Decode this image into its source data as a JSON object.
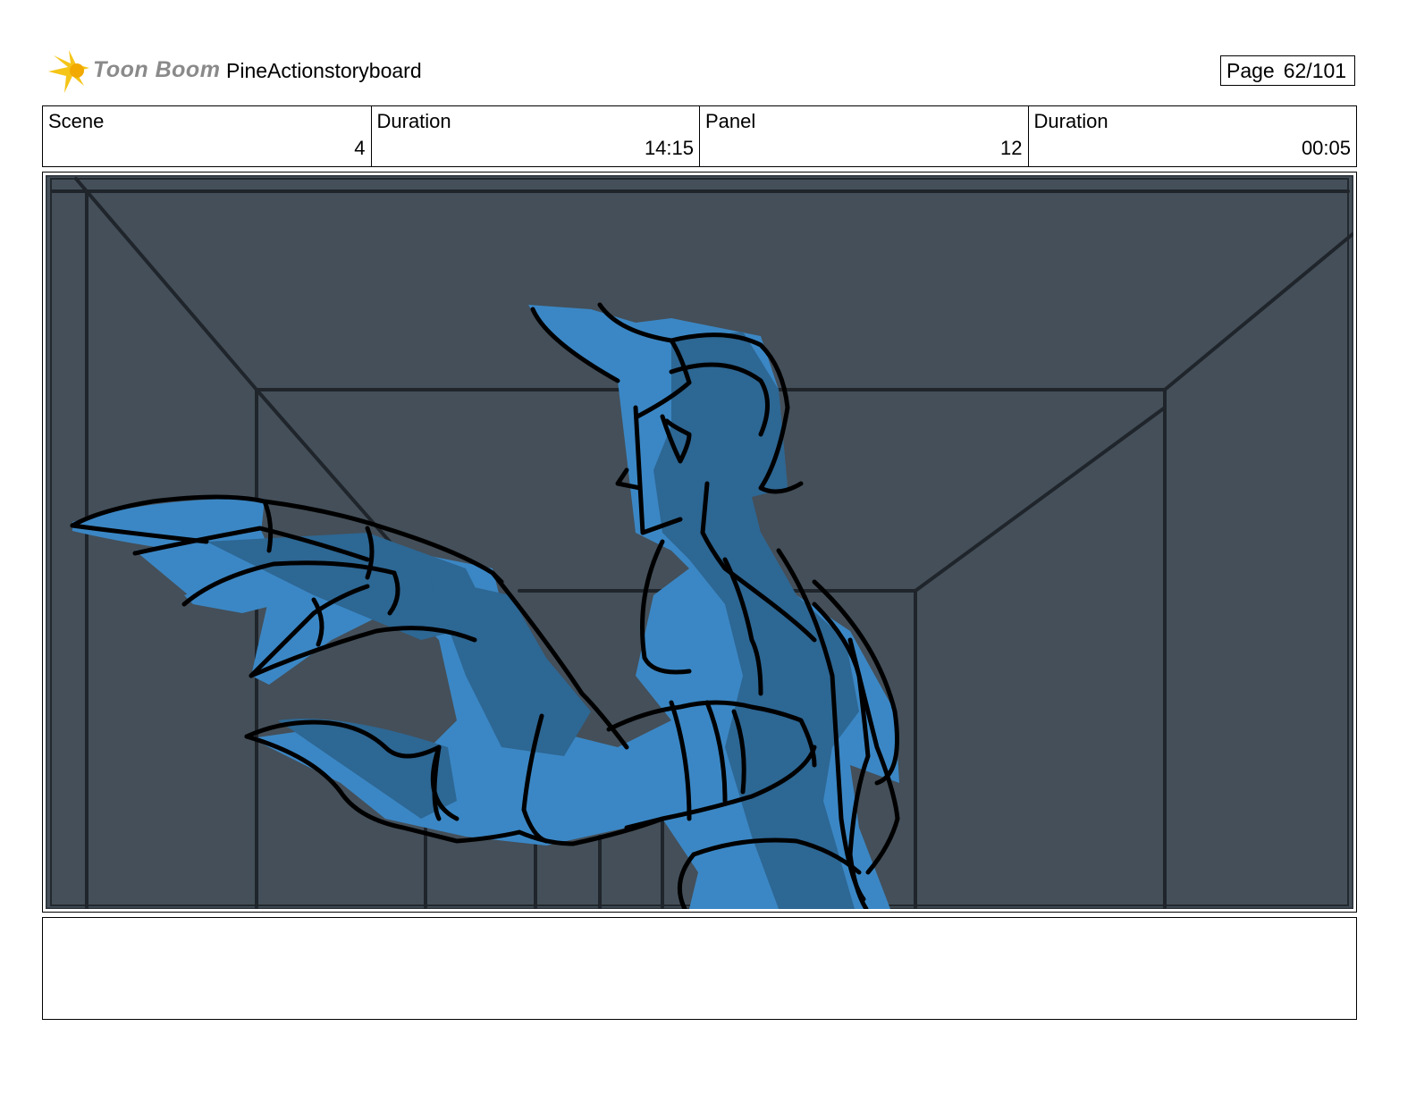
{
  "header": {
    "logo_text": "Toon Boom",
    "project_title": "PineActionstoryboard",
    "page_label": "Page",
    "page_number": "62/101"
  },
  "info": {
    "scene_label": "Scene",
    "scene_value": "4",
    "scene_duration_label": "Duration",
    "scene_duration_value": "14:15",
    "panel_label": "Panel",
    "panel_value": "12",
    "panel_duration_label": "Duration",
    "panel_duration_value": "00:05"
  },
  "colors": {
    "background": "#444f59",
    "character_fill": "#3b87c5",
    "character_shadow": "#2d6794",
    "line": "#000000",
    "logo_accent": "#f5c518"
  }
}
